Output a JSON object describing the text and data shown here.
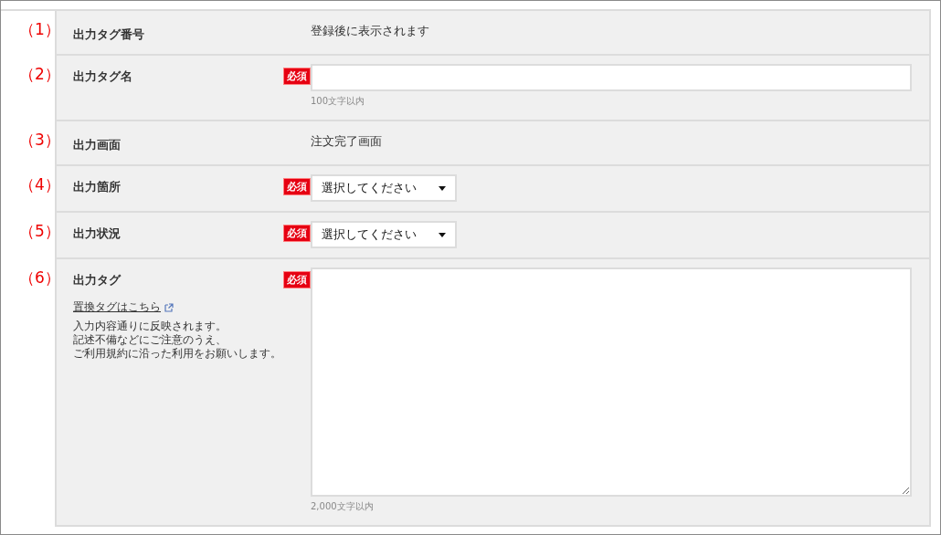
{
  "rows": [
    {
      "number": "（1）",
      "label": "出力タグ番号",
      "required": false,
      "kind": "text",
      "value": "登録後に表示されます"
    },
    {
      "number": "（2）",
      "label": "出力タグ名",
      "required": true,
      "required_label": "必須",
      "kind": "input",
      "hint": "100文字以内"
    },
    {
      "number": "（3）",
      "label": "出力画面",
      "required": false,
      "kind": "text",
      "value": "注文完了画面"
    },
    {
      "number": "（4）",
      "label": "出力箇所",
      "required": true,
      "required_label": "必須",
      "kind": "select",
      "value": "選択してください"
    },
    {
      "number": "（5）",
      "label": "出力状況",
      "required": true,
      "required_label": "必須",
      "kind": "select",
      "value": "選択してください"
    },
    {
      "number": "（6）",
      "label": "出力タグ",
      "required": true,
      "required_label": "必須",
      "kind": "textarea",
      "hint": "2,000文字以内",
      "link": "置換タグはこちら",
      "note": [
        "入力内容通りに反映されます。",
        "記述不備などにご注意のうえ、",
        "ご利用規約に沿った利用をお願いします。"
      ]
    }
  ]
}
